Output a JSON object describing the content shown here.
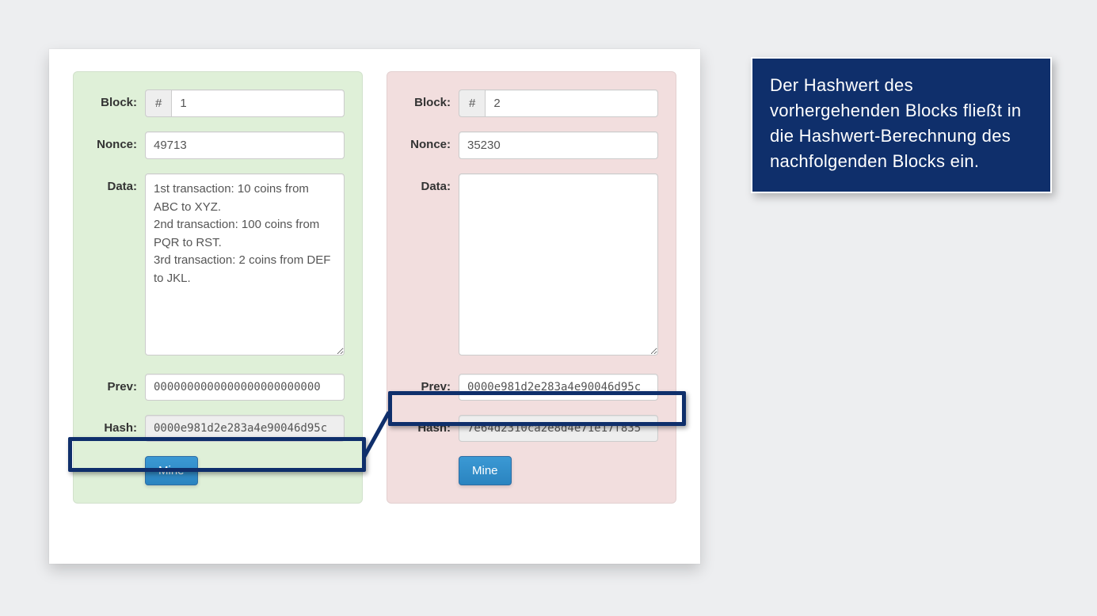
{
  "labels": {
    "block": "Block:",
    "nonce": "Nonce:",
    "data": "Data:",
    "prev": "Prev:",
    "hash": "Hash:",
    "mine": "Mine",
    "num_prefix": "#"
  },
  "blocks": [
    {
      "status": "ok",
      "number": "1",
      "nonce": "49713",
      "data": "1st transaction: 10 coins from ABC to XYZ.\n2nd transaction: 100 coins from PQR to RST.\n3rd transaction: 2 coins from DEF to JKL.",
      "prev": "0000000000000000000000000",
      "hash": "0000e981d2e283a4e90046d95c"
    },
    {
      "status": "invalid",
      "number": "2",
      "nonce": "35230",
      "data": "",
      "prev": "0000e981d2e283a4e90046d95c",
      "hash": "7e64d2310ca2e8d4e71e17f835"
    }
  ],
  "callout": {
    "text": "Der Hashwert des vorhergehenden Blocks fließt in die Hashwert-Berechnung des nachfolgenden Blocks ein."
  },
  "annotation": {
    "highlight_color": "#0f2f6b",
    "connects": {
      "from": "block1.hash",
      "to": "block2.prev"
    }
  }
}
